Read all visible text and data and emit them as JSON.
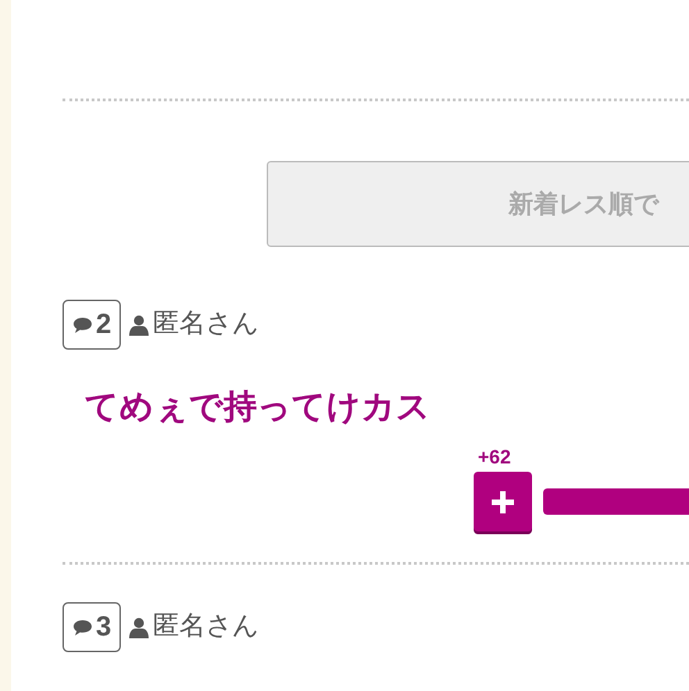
{
  "sort_button": {
    "label": "新着レス順で"
  },
  "posts": [
    {
      "number": "2",
      "author": "匿名さん",
      "body": "てめぇで持ってけカス",
      "vote_count": "+62"
    },
    {
      "number": "3",
      "author": "匿名さん"
    }
  ]
}
